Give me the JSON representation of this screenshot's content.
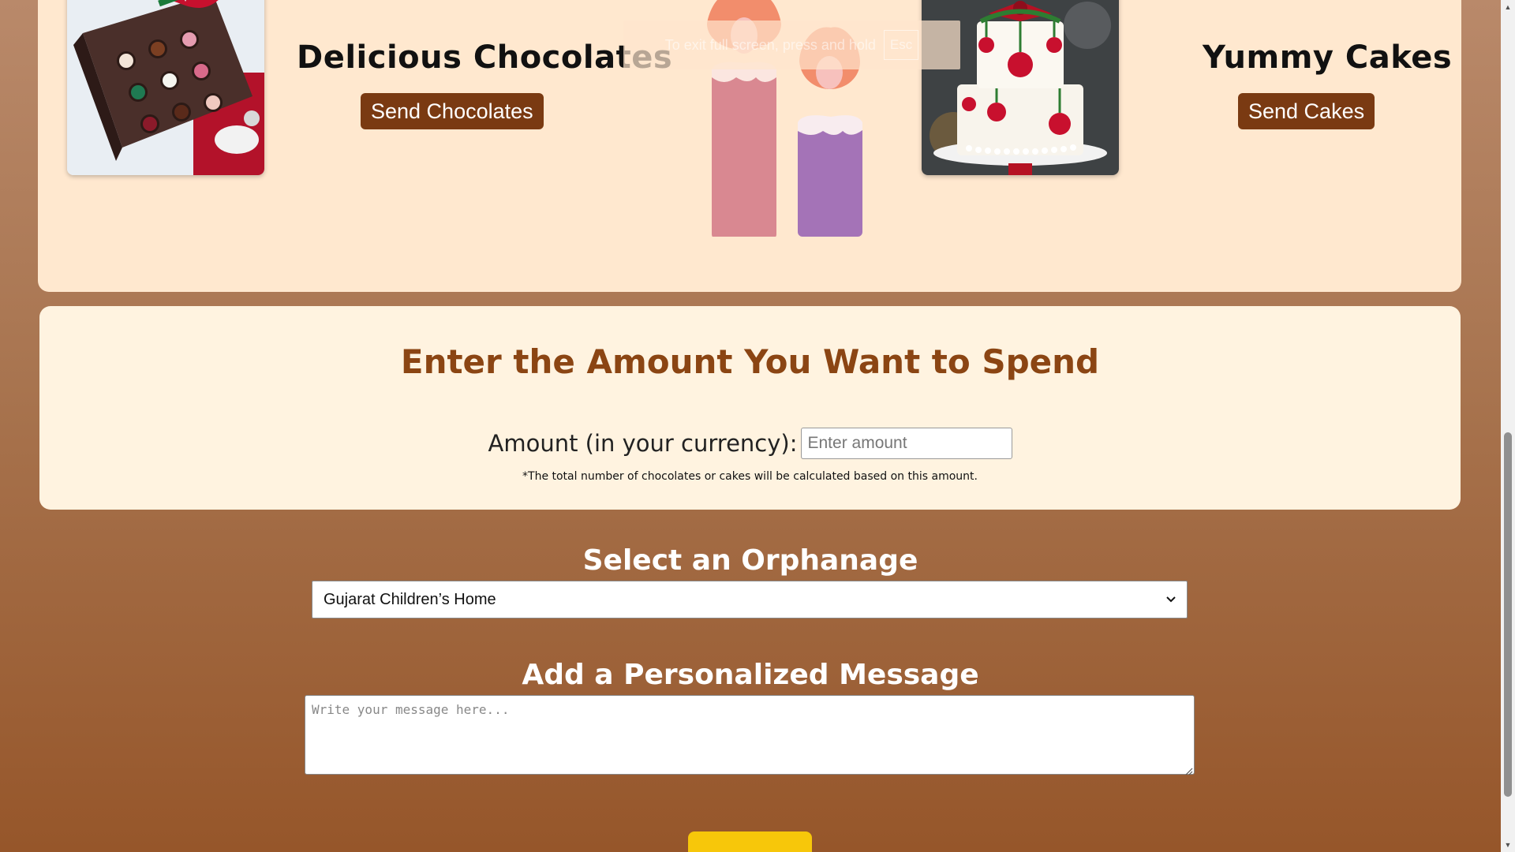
{
  "products": {
    "chocolates": {
      "title": "Delicious Chocolates",
      "button_label": "Send Chocolates"
    },
    "cakes": {
      "title": "Yummy Cakes",
      "button_label": "Send Cakes"
    }
  },
  "fullscreen_notice": {
    "text": "To exit full screen, press and hold",
    "key": "Esc"
  },
  "amount": {
    "title": "Enter the Amount You Want to Spend",
    "label": "Amount (in your currency):",
    "placeholder": "Enter amount",
    "note": "*The total number of chocolates or cakes will be calculated based on this amount."
  },
  "orphanage": {
    "title": "Select an Orphanage",
    "selected": "Gujarat Children’s Home"
  },
  "message": {
    "title": "Add a Personalized Message",
    "placeholder": "Write your message here..."
  },
  "colors": {
    "page_gradient_top": "#b9896a",
    "page_gradient_bottom": "#96562a",
    "card_background": "#ffe8cf",
    "amount_card_background": "#fff3e0",
    "button_brown": "#7a3a12",
    "heading_brown": "#8b4513",
    "submit_yellow": "#f7c70a"
  },
  "icons": {
    "select_arrow": "chevron-down-icon",
    "textarea_resize": "resize-grip-icon"
  }
}
